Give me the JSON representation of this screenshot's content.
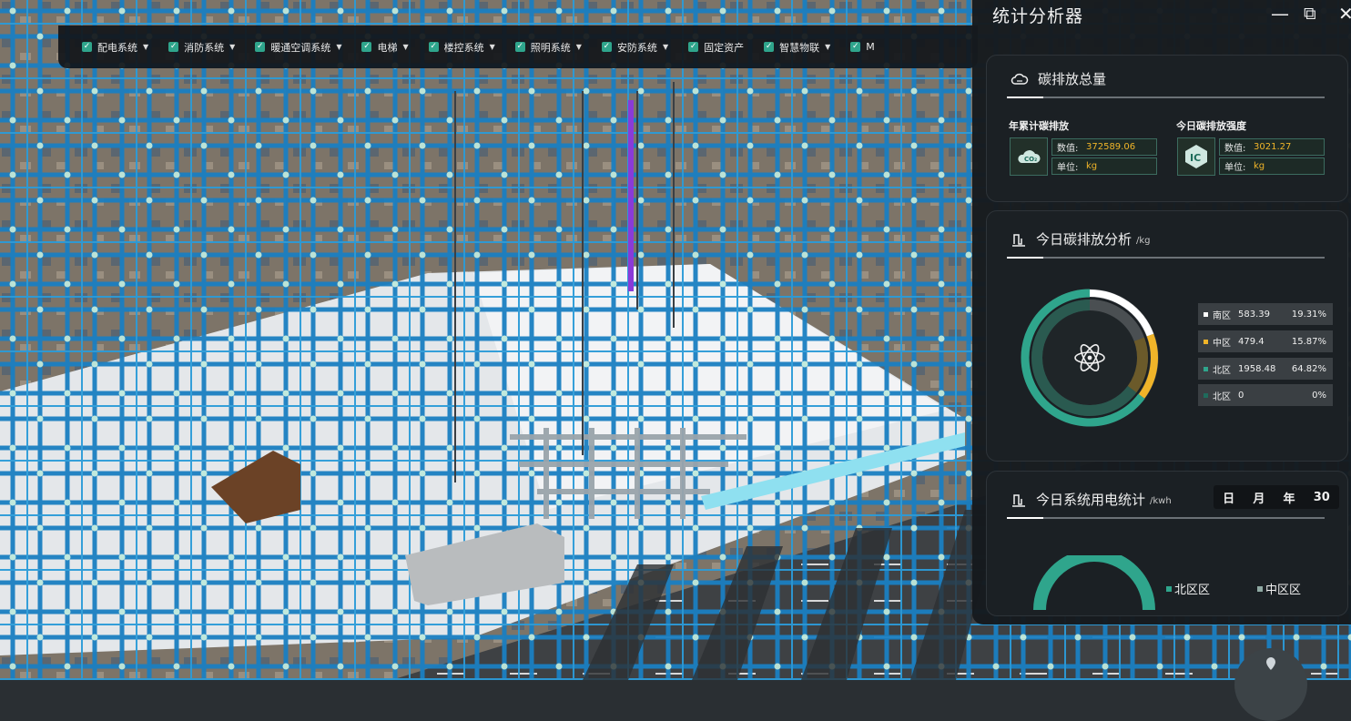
{
  "toolbar": {
    "items": [
      {
        "label": "配电系统"
      },
      {
        "label": "消防系统"
      },
      {
        "label": "暖通空调系统"
      },
      {
        "label": "电梯"
      },
      {
        "label": "楼控系统"
      },
      {
        "label": "照明系统"
      },
      {
        "label": "安防系统"
      },
      {
        "label": "固定资产"
      },
      {
        "label": "智慧物联"
      },
      {
        "label": "M"
      }
    ]
  },
  "panel": {
    "title": "统计分析器",
    "minimize": "—",
    "maximize": "⧉",
    "close": "✕"
  },
  "carbon_total": {
    "title": "碳排放总量",
    "annual": {
      "label": "年累计碳排放",
      "value_key": "数值:",
      "value": "372589.06",
      "unit_key": "单位:",
      "unit": "kg",
      "icon": "co2-cloud-icon"
    },
    "today": {
      "label": "今日碳排放强度",
      "value_key": "数值:",
      "value": "3021.27",
      "unit_key": "单位:",
      "unit": "kg",
      "icon": "ic-hexagon-icon"
    }
  },
  "carbon_analysis": {
    "title": "今日碳排放分析",
    "unit": "/kg",
    "center_icon": "atom-icon",
    "colors": {
      "south": "#ffffff",
      "middle": "#f0b429",
      "north": "#2fa58c",
      "north2": "#1f6b5c"
    },
    "legend": [
      {
        "name": "南区",
        "value": "583.39",
        "percent": "19.31%",
        "color": "#ffffff"
      },
      {
        "name": "中区",
        "value": "479.4",
        "percent": "15.87%",
        "color": "#f0b429"
      },
      {
        "name": "北区",
        "value": "1958.48",
        "percent": "64.82%",
        "color": "#2fa58c"
      },
      {
        "name": "北区",
        "value": "0",
        "percent": "0%",
        "color": "#1f6b5c"
      }
    ]
  },
  "chart_data": {
    "type": "pie",
    "categories": [
      "南区",
      "中区",
      "北区",
      "北区"
    ],
    "values": [
      583.39,
      479.4,
      1958.48,
      0
    ],
    "percent": [
      19.31,
      15.87,
      64.82,
      0
    ]
  },
  "power_stats": {
    "title": "今日系统用电统计",
    "unit": "/kwh",
    "periods": [
      "日",
      "月",
      "年",
      "30"
    ],
    "legend": [
      {
        "name": "北区区",
        "color": "#2fa58c"
      },
      {
        "name": "中区区",
        "color": "#8fa9a3"
      }
    ]
  }
}
